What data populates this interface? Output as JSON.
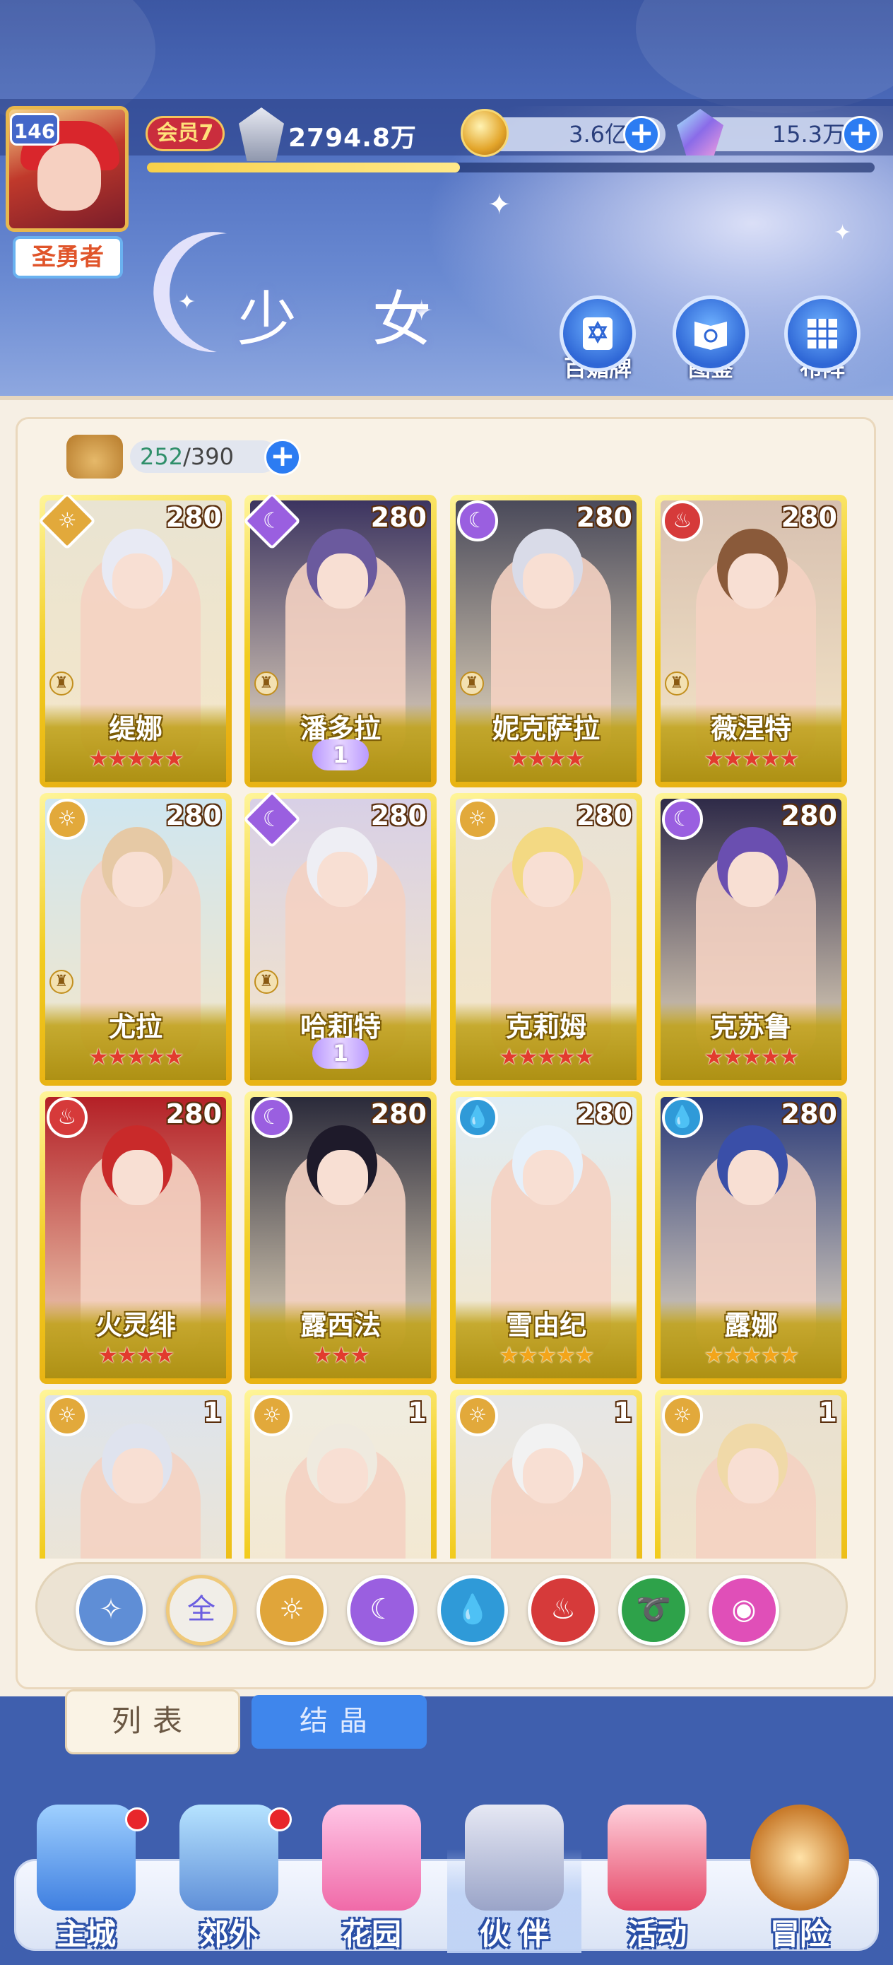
{
  "player": {
    "level": "146",
    "title": "圣勇者",
    "vip": "会员7",
    "power": "2794.8万",
    "exp_progress": 0.43
  },
  "resources": {
    "gold": "3.6亿",
    "gems": "15.3万"
  },
  "page": {
    "title": "少 女",
    "nav": [
      {
        "label": "百媚牌",
        "icon": "card-badge-icon"
      },
      {
        "label": "图鉴",
        "icon": "book-icon"
      },
      {
        "label": "布阵",
        "icon": "grid-formation-icon"
      }
    ]
  },
  "capacity": {
    "used": "252",
    "total": "/390"
  },
  "cards": [
    {
      "name": "缇娜",
      "level": "280",
      "element": "light",
      "stars": 5,
      "star_color": "red",
      "badge": "",
      "frame": "diamond"
    },
    {
      "name": "潘多拉",
      "level": "280",
      "element": "moon",
      "stars": 0,
      "star_color": "red",
      "badge": "1",
      "frame": "diamond"
    },
    {
      "name": "妮克萨拉",
      "level": "280",
      "element": "moon",
      "stars": 4,
      "star_color": "red",
      "badge": "",
      "frame": "circle"
    },
    {
      "name": "薇涅特",
      "level": "280",
      "element": "fire",
      "stars": 5,
      "star_color": "red",
      "badge": "",
      "frame": "circle"
    },
    {
      "name": "尤拉",
      "level": "280",
      "element": "light",
      "stars": 5,
      "star_color": "red",
      "badge": "",
      "frame": "circle"
    },
    {
      "name": "哈莉特",
      "level": "280",
      "element": "moon",
      "stars": 0,
      "star_color": "red",
      "badge": "1",
      "frame": "diamond"
    },
    {
      "name": "克莉姆",
      "level": "280",
      "element": "light",
      "stars": 5,
      "star_color": "red",
      "badge": "",
      "frame": "circle"
    },
    {
      "name": "克苏鲁",
      "level": "280",
      "element": "moon",
      "stars": 5,
      "star_color": "red",
      "badge": "",
      "frame": "circle"
    },
    {
      "name": "火灵绯",
      "level": "280",
      "element": "fire",
      "stars": 4,
      "star_color": "red",
      "badge": "",
      "frame": "circle"
    },
    {
      "name": "露西法",
      "level": "280",
      "element": "moon",
      "stars": 3,
      "star_color": "red",
      "badge": "",
      "frame": "circle"
    },
    {
      "name": "雪由纪",
      "level": "280",
      "element": "water",
      "stars": 5,
      "star_color": "gold",
      "badge": "",
      "frame": "circle"
    },
    {
      "name": "露娜",
      "level": "280",
      "element": "water",
      "stars": 5,
      "star_color": "gold",
      "badge": "",
      "frame": "circle"
    },
    {
      "name": "",
      "level": "1",
      "element": "light",
      "stars": 0,
      "star_color": "red",
      "badge": "",
      "frame": "circle"
    },
    {
      "name": "",
      "level": "1",
      "element": "light",
      "stars": 0,
      "star_color": "red",
      "badge": "",
      "frame": "circle"
    },
    {
      "name": "",
      "level": "1",
      "element": "light",
      "stars": 0,
      "star_color": "red",
      "badge": "",
      "frame": "circle"
    },
    {
      "name": "",
      "level": "1",
      "element": "light",
      "stars": 0,
      "star_color": "red",
      "badge": "",
      "frame": "circle"
    }
  ],
  "filters": [
    {
      "label": "",
      "icon": "wing-icon",
      "color": "#5f8ed6"
    },
    {
      "label": "全",
      "icon": "all-icon",
      "color": "#f1eee8",
      "selected": true
    },
    {
      "label": "",
      "icon": "sun-icon",
      "color": "#e0a53a"
    },
    {
      "label": "",
      "icon": "moon-icon",
      "color": "#9a5fe0"
    },
    {
      "label": "",
      "icon": "water-drop-icon",
      "color": "#2f9ad8"
    },
    {
      "label": "",
      "icon": "flame-icon",
      "color": "#d63a3a"
    },
    {
      "label": "",
      "icon": "whirlwind-icon",
      "color": "#2ea24a"
    },
    {
      "label": "",
      "icon": "orbit-icon",
      "color": "#e04fb8"
    }
  ],
  "tabs": {
    "list": "列表",
    "crystal": "结晶"
  },
  "bottom_nav": [
    {
      "label": "主城",
      "dot": true
    },
    {
      "label": "郊外",
      "dot": true
    },
    {
      "label": "花园",
      "dot": false
    },
    {
      "label": "伙 伴",
      "dot": false,
      "active": true
    },
    {
      "label": "活动",
      "dot": false
    },
    {
      "label": "冒险",
      "dot": false
    }
  ],
  "colors": {
    "header_bg": "#4f6fc0",
    "card_gold": "#f2cc1f",
    "accent_blue": "#2c7cf2",
    "star_red": "#e23b2e",
    "star_gold": "#f3a51a"
  }
}
